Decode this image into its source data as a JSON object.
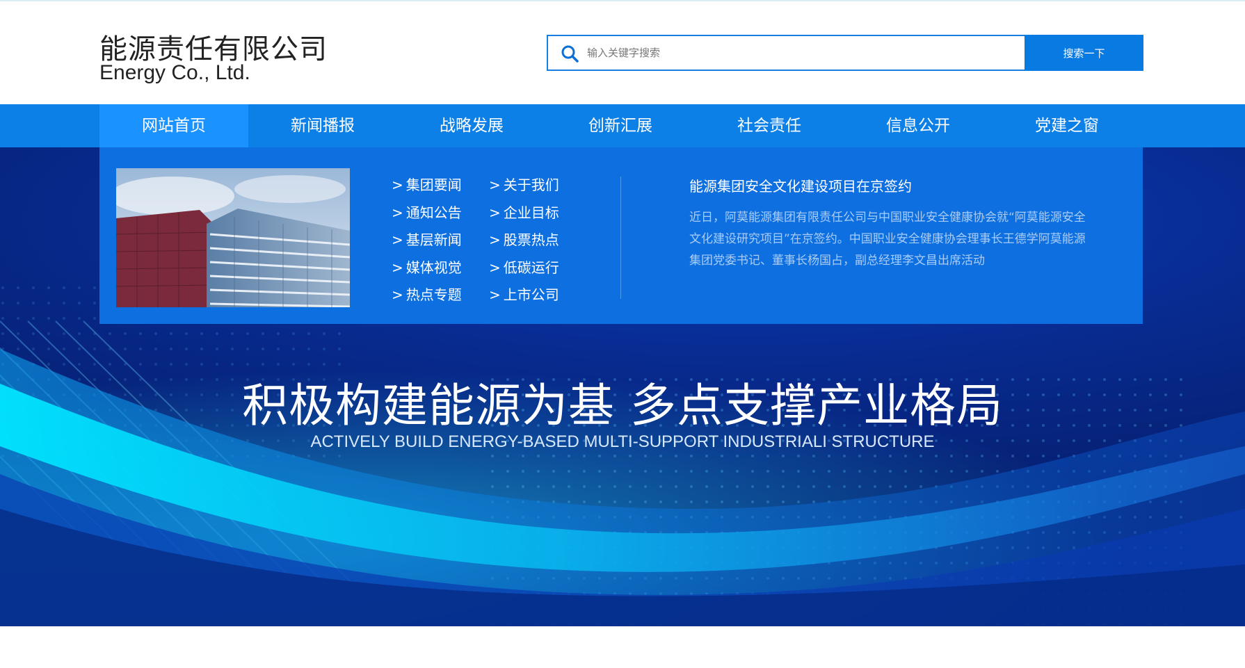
{
  "header": {
    "logo_cn": "能源责任有限公司",
    "logo_en": "Energy Co., Ltd."
  },
  "search": {
    "placeholder": "输入关键字搜索",
    "button_label": "搜索一下",
    "icon": "search-icon"
  },
  "nav": {
    "items": [
      {
        "label": "网站首页",
        "active": true
      },
      {
        "label": "新闻播报"
      },
      {
        "label": "战略发展"
      },
      {
        "label": "创新汇展"
      },
      {
        "label": "社会责任"
      },
      {
        "label": "信息公开"
      },
      {
        "label": "党建之窗"
      }
    ]
  },
  "dropdown": {
    "arrow": ">",
    "col1": [
      "集团要闻",
      "通知公告",
      "基层新闻",
      "媒体视觉",
      "热点专题"
    ],
    "col2": [
      "关于我们",
      "企业目标",
      "股票热点",
      "低碳运行",
      "上市公司"
    ],
    "news_title": "能源集团安全文化建设项目在京签约",
    "news_body": "近日，阿莫能源集团有限责任公司与中国职业安全健康协会就“阿莫能源安全文化建设研究项目”在京签约。中国职业安全健康协会理事长王德学阿莫能源集团党委书记、董事长杨国占，副总经理李文昌出席活动"
  },
  "banner": {
    "title": "积极构建能源为基 多点支撑产业格局",
    "subtitle": "ACTIVELY BUILD ENERGY-BASED MULTI-SUPPORT INDUSTRIALI STRUCTURE"
  },
  "colors": {
    "brand_blue": "#0c80e6",
    "nav_active": "#1a92ff",
    "panel_blue": "#0e6fe0",
    "banner_dark": "#061f70"
  }
}
